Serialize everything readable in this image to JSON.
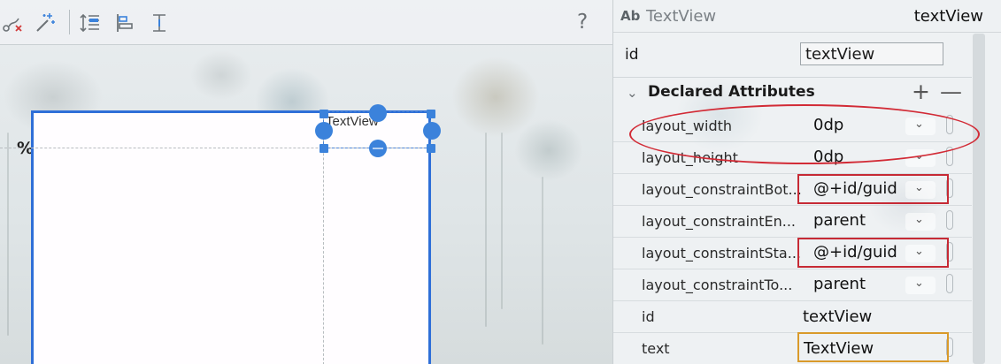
{
  "toolbar": {
    "icons": [
      "clear-constraints-icon",
      "infer-constraints-icon",
      "pack-icon",
      "align-icon",
      "guidelines-icon"
    ],
    "help_label": "?"
  },
  "canvas": {
    "percent_label": "%",
    "textview_label": "TextView",
    "accent": "#2f6fd8"
  },
  "attributes": {
    "header": {
      "ab_label": "Ab",
      "component_type": "TextView",
      "component_id": "textView"
    },
    "id_label": "id",
    "id_value": "textView",
    "section_title": "Declared Attributes",
    "add_symbol": "+",
    "remove_symbol": "—",
    "rows": [
      {
        "name": "layout_width",
        "value": "0dp"
      },
      {
        "name": "layout_height",
        "value": "0dp"
      },
      {
        "name": "layout_constraintBot...",
        "value": "@+id/guid"
      },
      {
        "name": "layout_constraintEn...",
        "value": "parent"
      },
      {
        "name": "layout_constraintSta...",
        "value": "@+id/guid"
      },
      {
        "name": "layout_constraintTo...",
        "value": "parent"
      },
      {
        "name": "id",
        "value": "textView"
      },
      {
        "name": "text",
        "value": "TextView"
      }
    ],
    "dropdown_glyph": "⌄",
    "highlight_colors": {
      "red": "#c62a35",
      "orange": "#d99a2a"
    }
  }
}
